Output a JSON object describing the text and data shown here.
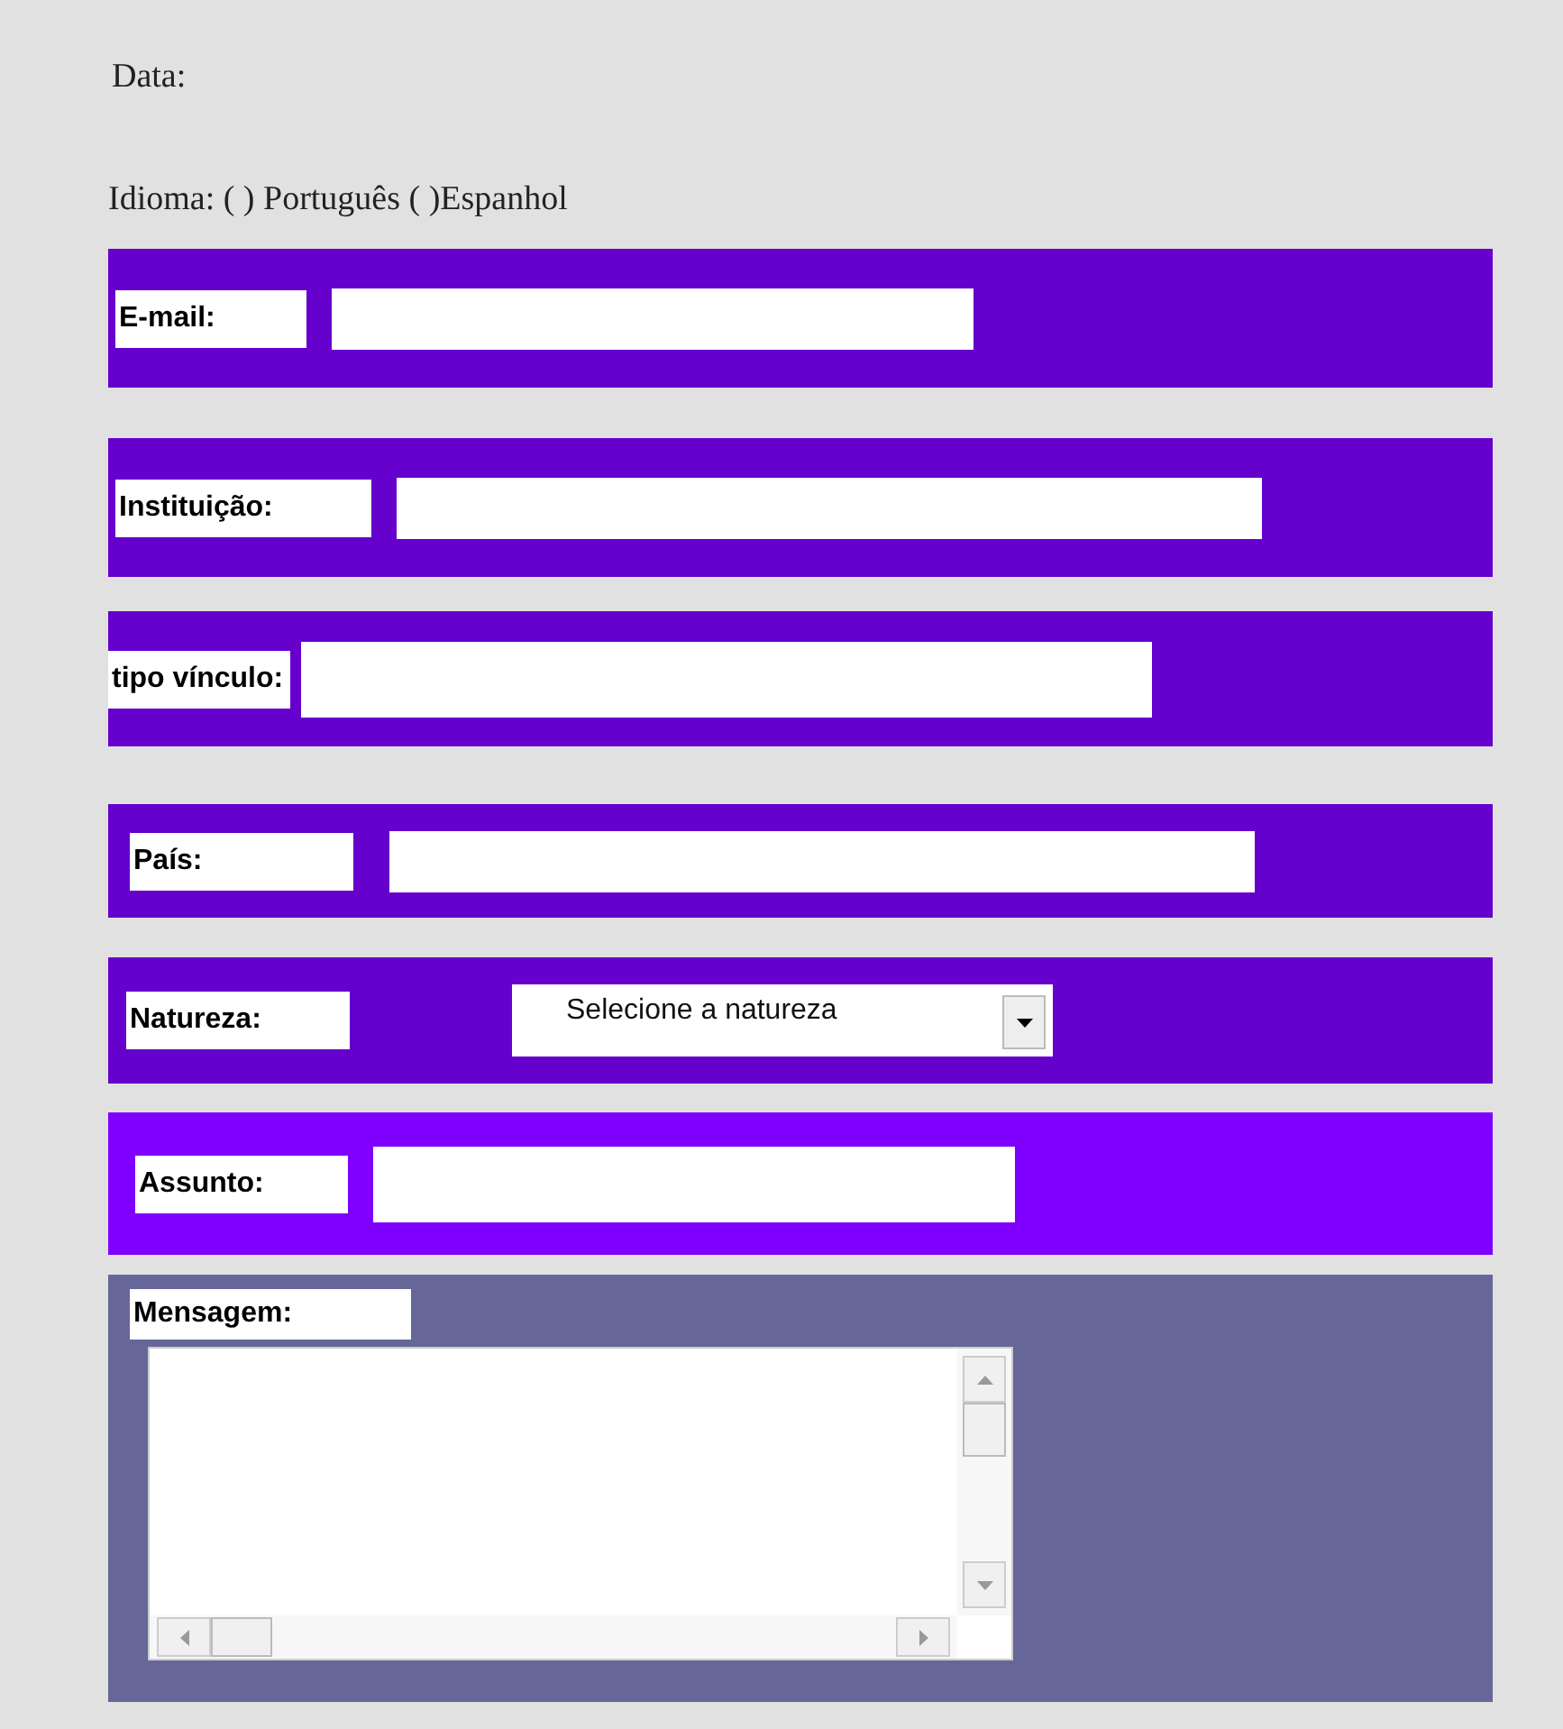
{
  "date_label": "Data:",
  "language_line": "Idioma: ( ) Português  ( )Espanhol",
  "fields": [
    {
      "kind": "text",
      "label": "E-mail:",
      "color": "#6600cc"
    },
    {
      "kind": "text",
      "label": "Instituição:",
      "color": "#6600cc"
    },
    {
      "kind": "text",
      "label": "tipo vínculo:",
      "color": "#6600cc"
    },
    {
      "kind": "text",
      "label": "País:",
      "color": "#6600cc"
    },
    {
      "kind": "select",
      "label": "Natureza:",
      "value": "Selecione a natureza",
      "color": "#6600cc"
    },
    {
      "kind": "text",
      "label": "Assunto:",
      "color": "#8000ff"
    },
    {
      "kind": "textarea",
      "label": "Mensagem:",
      "color": "#666699"
    }
  ]
}
